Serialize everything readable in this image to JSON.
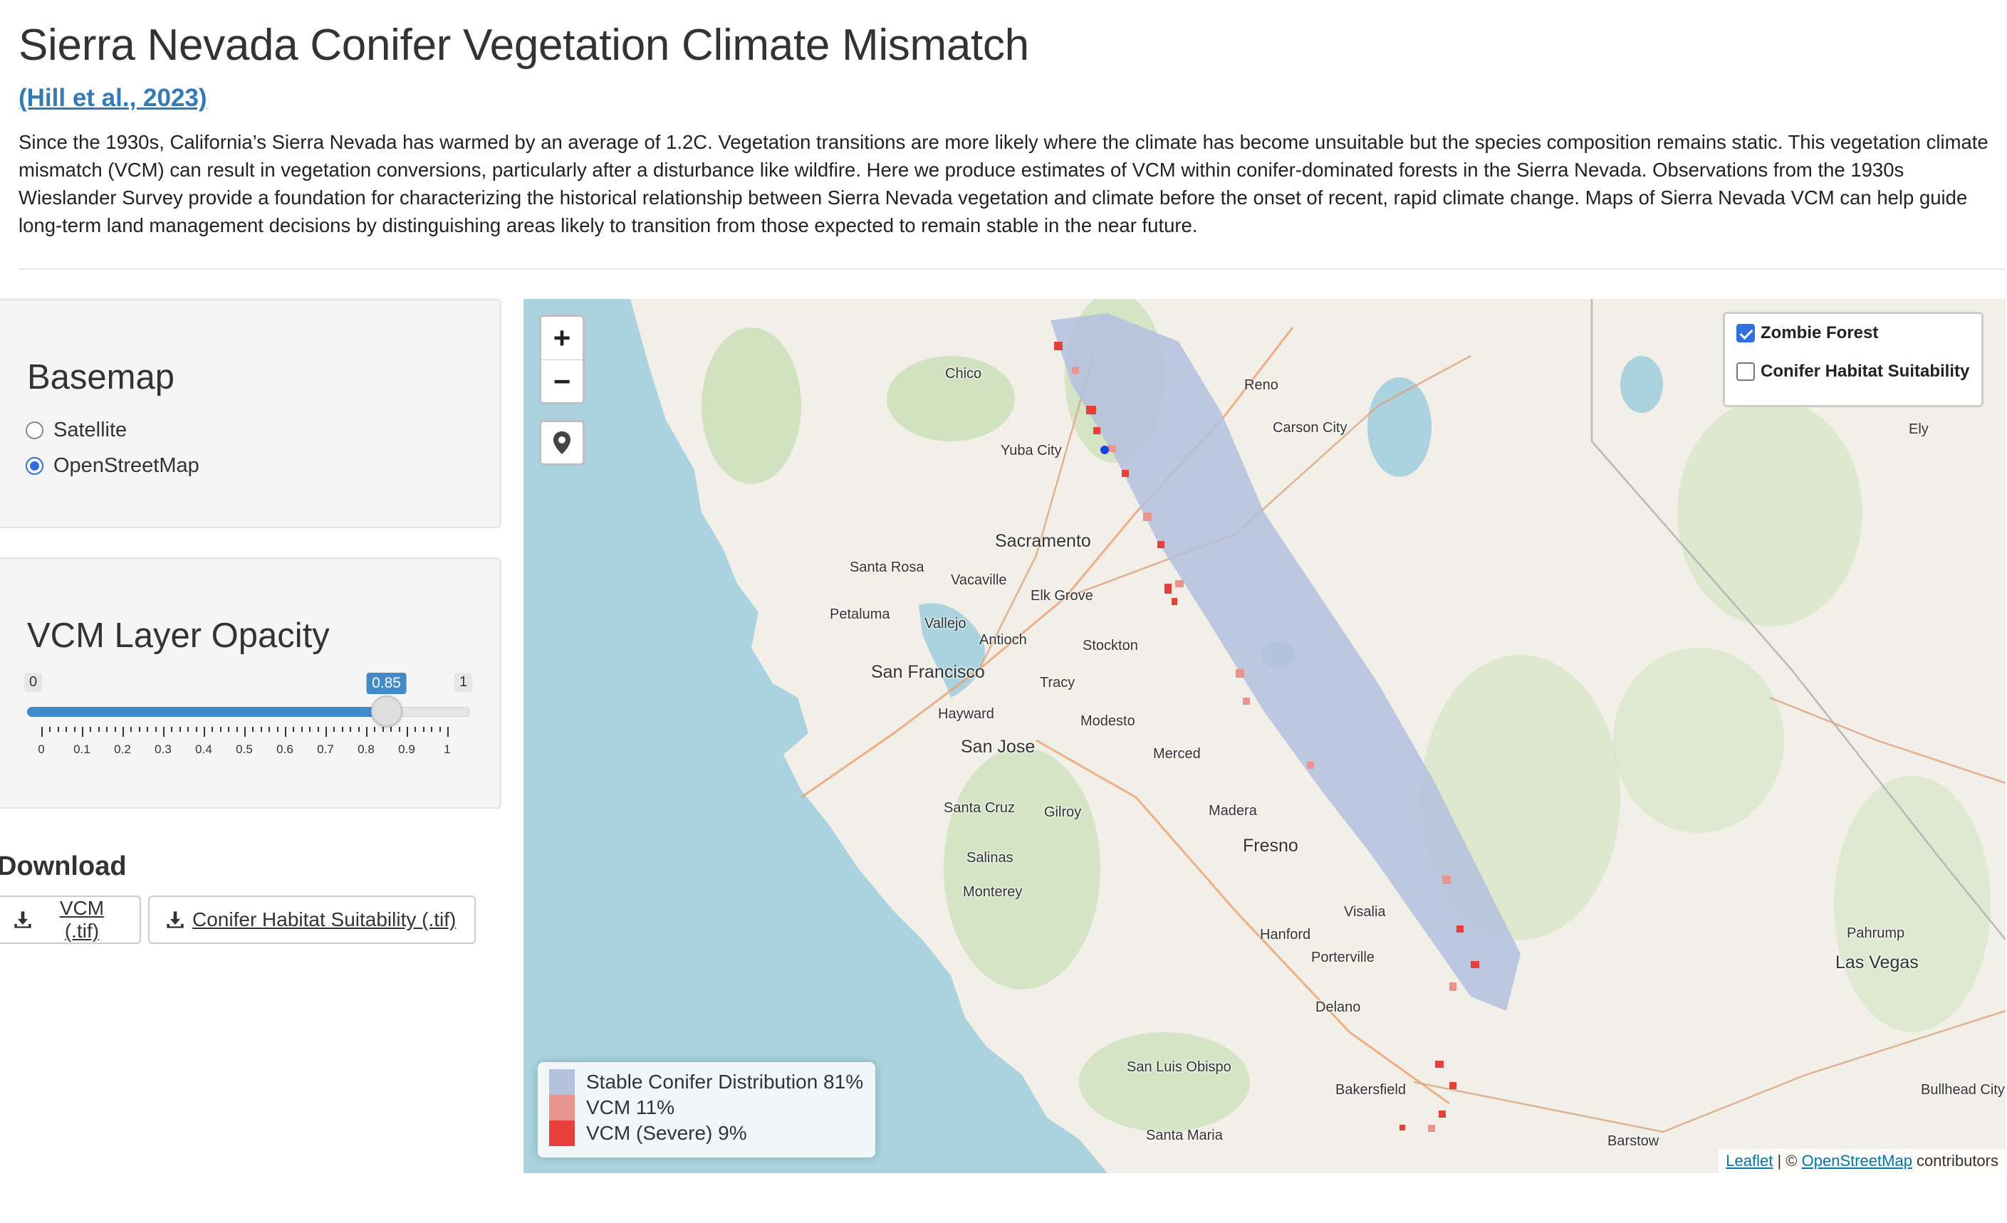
{
  "header": {
    "title": "Sierra Nevada Conifer Vegetation Climate Mismatch",
    "citation": "(Hill et al., 2023)",
    "description": "Since the 1930s, California’s Sierra Nevada has warmed by an average of 1.2C. Vegetation transitions are more likely where the climate has become unsuitable but the species composition remains static. This vegetation climate mismatch (VCM) can result in vegetation conversions, particularly after a disturbance like wildfire. Here we produce estimates of VCM within conifer-dominated forests in the Sierra Nevada. Observations from the 1930s Wieslander Survey provide a foundation for characterizing the historical relationship between Sierra Nevada vegetation and climate before the onset of recent, rapid climate change. Maps of Sierra Nevada VCM can help guide long-term land management decisions by distinguishing areas likely to transition from those expected to remain stable in the near future."
  },
  "basemap": {
    "title": "Basemap",
    "options": [
      {
        "label": "Satellite",
        "selected": false
      },
      {
        "label": "OpenStreetMap",
        "selected": true
      }
    ]
  },
  "opacity": {
    "title": "VCM Layer Opacity",
    "min": 0,
    "max": 1,
    "value": 0.85,
    "min_label": "0",
    "max_label": "1",
    "value_label": "0.85",
    "ticks": [
      "0",
      "0.1",
      "0.2",
      "0.3",
      "0.4",
      "0.5",
      "0.6",
      "0.7",
      "0.8",
      "0.9",
      "1"
    ]
  },
  "download": {
    "title": "Download",
    "vcm_button": "VCM (.tif)",
    "suitability_button": "Conifer Habitat Suitability (.tif)"
  },
  "map": {
    "zoom_in": "+",
    "zoom_out": "−",
    "layers": [
      {
        "label": "Zombie Forest",
        "checked": true
      },
      {
        "label": "Conifer Habitat Suitability",
        "checked": false
      }
    ],
    "legend": [
      {
        "label": "Stable Conifer Distribution 81%",
        "color": "#b3c0de"
      },
      {
        "label": "VCM 11%",
        "color": "#e8958f"
      },
      {
        "label": "VCM (Severe) 9%",
        "color": "#e5413a"
      }
    ],
    "attribution": {
      "leaflet": "Leaflet",
      "sep": " | © ",
      "osm": "OpenStreetMap",
      "tail": " contributors"
    },
    "cities": [
      {
        "name": "Chico"
      },
      {
        "name": "Reno"
      },
      {
        "name": "Carson City"
      },
      {
        "name": "Ely"
      },
      {
        "name": "Yuba City"
      },
      {
        "name": "Sacramento"
      },
      {
        "name": "Santa Rosa"
      },
      {
        "name": "Vacaville"
      },
      {
        "name": "Elk Grove"
      },
      {
        "name": "Petaluma"
      },
      {
        "name": "Vallejo"
      },
      {
        "name": "Antioch"
      },
      {
        "name": "Stockton"
      },
      {
        "name": "San Francisco"
      },
      {
        "name": "Tracy"
      },
      {
        "name": "Hayward"
      },
      {
        "name": "Modesto"
      },
      {
        "name": "San Jose"
      },
      {
        "name": "Merced"
      },
      {
        "name": "Santa Cruz"
      },
      {
        "name": "Gilroy"
      },
      {
        "name": "Madera"
      },
      {
        "name": "Fresno"
      },
      {
        "name": "Salinas"
      },
      {
        "name": "Monterey"
      },
      {
        "name": "Visalia"
      },
      {
        "name": "Hanford"
      },
      {
        "name": "Porterville"
      },
      {
        "name": "Pahrump"
      },
      {
        "name": "Las Vegas"
      },
      {
        "name": "Delano"
      },
      {
        "name": "San Luis Obispo"
      },
      {
        "name": "Bakersfield"
      },
      {
        "name": "Bullhead City"
      },
      {
        "name": "Santa Maria"
      },
      {
        "name": "Barstow"
      }
    ]
  },
  "colors": {
    "accent": "#428bca",
    "link": "#337ab7",
    "ocean": "#aad3df",
    "land": "#f2efe9"
  }
}
